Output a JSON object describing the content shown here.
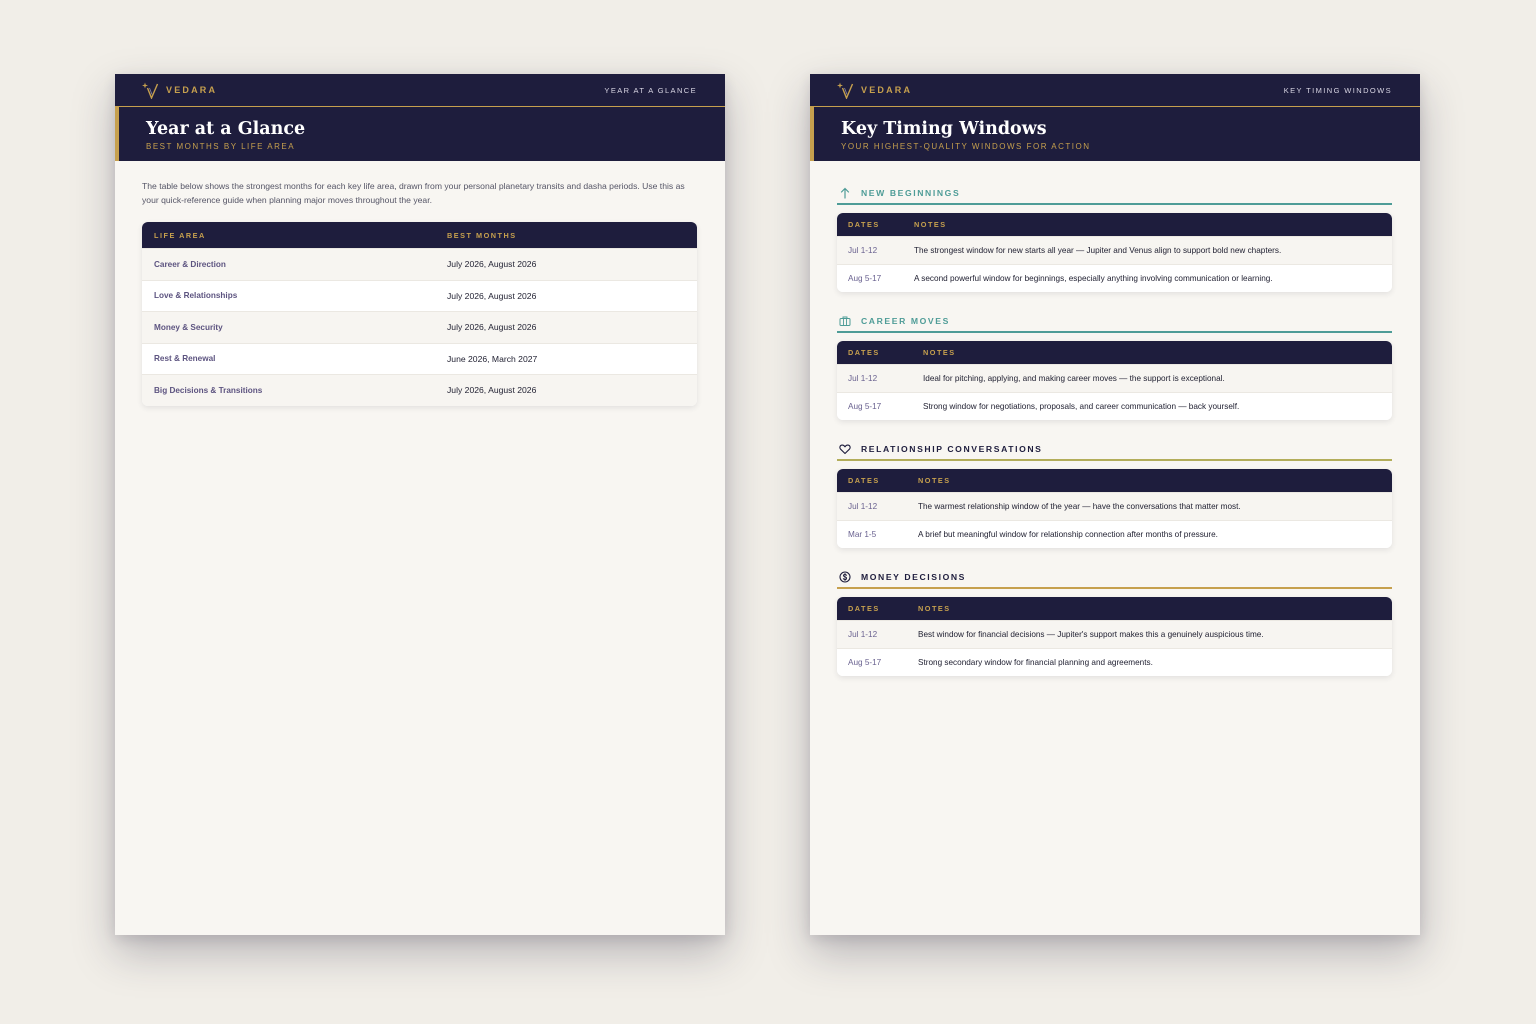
{
  "brand": {
    "name": "VEDARA"
  },
  "colors": {
    "navy": "#1e1d3d",
    "gold": "#c6a04e",
    "teal": "#4e9c97",
    "olive": "#b3ad5a",
    "paper": "#f8f6f2",
    "backdrop": "#f1eee8"
  },
  "left_page": {
    "header_section": "YEAR AT A GLANCE",
    "title": "Year at a Glance",
    "subtitle": "BEST MONTHS BY LIFE AREA",
    "intro": "The table below shows the strongest months for each key life area, drawn from your personal planetary transits and dasha periods. Use this as your quick-reference guide when planning major moves throughout the year.",
    "table": {
      "headers": [
        "LIFE AREA",
        "BEST MONTHS"
      ],
      "rows": [
        {
          "area": "Career & Direction",
          "months": "July 2026, August 2026"
        },
        {
          "area": "Love & Relationships",
          "months": "July 2026, August 2026"
        },
        {
          "area": "Money & Security",
          "months": "July 2026, August 2026"
        },
        {
          "area": "Rest & Renewal",
          "months": "June 2026, March 2027"
        },
        {
          "area": "Big Decisions & Transitions",
          "months": "July 2026, August 2026"
        }
      ]
    }
  },
  "right_page": {
    "header_section": "KEY TIMING WINDOWS",
    "title": "Key Timing Windows",
    "subtitle": "YOUR HIGHEST-QUALITY WINDOWS FOR ACTION",
    "table_headers": [
      "DATES",
      "NOTES"
    ],
    "sections": [
      {
        "title": "NEW BEGINNINGS",
        "icon": "arrow-up-icon",
        "title_color": "#4e9c97",
        "rule_color": "#4e9c97",
        "rows": [
          {
            "date": "Jul 1-12",
            "note": "The strongest window for new starts all year — Jupiter and Venus align to support bold new chapters."
          },
          {
            "date": "Aug 5-17",
            "note": "A second powerful window for beginnings, especially anything involving communication or learning."
          }
        ]
      },
      {
        "title": "CAREER MOVES",
        "icon": "briefcase-icon",
        "title_color": "#4e9c97",
        "rule_color": "#4e9c97",
        "rows": [
          {
            "date": "Jul 1-12",
            "note": "Ideal for pitching, applying, and making career moves — the support is exceptional."
          },
          {
            "date": "Aug 5-17",
            "note": "Strong window for negotiations, proposals, and career communication — back yourself."
          }
        ]
      },
      {
        "title": "RELATIONSHIP CONVERSATIONS",
        "icon": "heart-icon",
        "title_color": "#1e1d3d",
        "rule_color": "#b3ad5a",
        "rows": [
          {
            "date": "Jul 1-12",
            "note": "The warmest relationship window of the year — have the conversations that matter most."
          },
          {
            "date": "Mar 1-5",
            "note": "A brief but meaningful window for relationship connection after months of pressure."
          }
        ]
      },
      {
        "title": "MONEY DECISIONS",
        "icon": "dollar-circle-icon",
        "title_color": "#1e1d3d",
        "rule_color": "#c6a04e",
        "rows": [
          {
            "date": "Jul 1-12",
            "note": "Best window for financial decisions — Jupiter's support makes this a genuinely auspicious time."
          },
          {
            "date": "Aug 5-17",
            "note": "Strong secondary window for financial planning and agreements."
          }
        ]
      }
    ]
  }
}
